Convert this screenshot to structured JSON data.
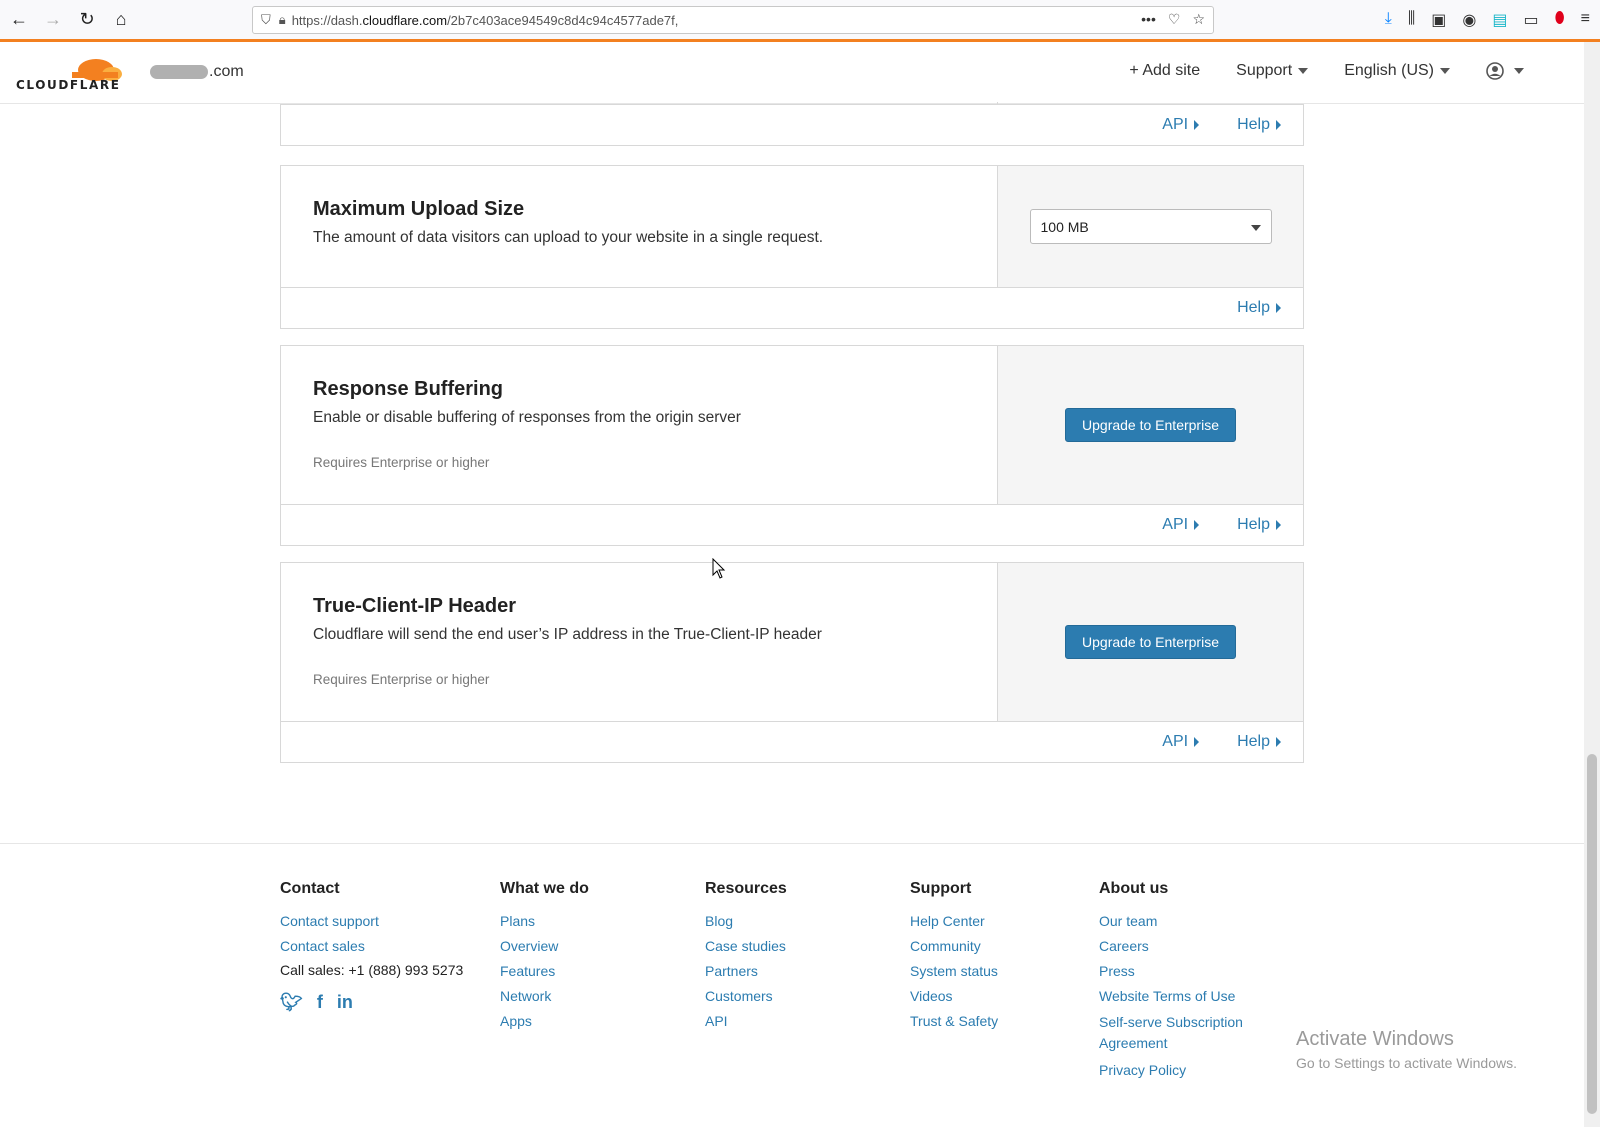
{
  "browser": {
    "url_prefix": "https://dash.",
    "url_host": "cloudflare.com",
    "url_path": "/2b7c403ace94549c8d4c94c4577ade7f,"
  },
  "header": {
    "logo_text": "CLOUDFLARE",
    "domain_suffix": ".com",
    "add_site": "+ Add site",
    "support": "Support",
    "language": "English (US)"
  },
  "top_card": {
    "api": "API",
    "help": "Help"
  },
  "cards": [
    {
      "title": "Maximum Upload Size",
      "desc": "The amount of data visitors can upload to your website in a single request.",
      "select_value": "100 MB",
      "help": "Help"
    },
    {
      "title": "Response Buffering",
      "desc": "Enable or disable buffering of responses from the origin server",
      "note": "Requires Enterprise or higher",
      "button": "Upgrade to Enterprise",
      "api": "API",
      "help": "Help"
    },
    {
      "title": "True-Client-IP Header",
      "desc": "Cloudflare will send the end user’s IP address in the True-Client-IP header",
      "note": "Requires Enterprise or higher",
      "button": "Upgrade to Enterprise",
      "api": "API",
      "help": "Help"
    }
  ],
  "footer": {
    "contact": {
      "title": "Contact",
      "links": [
        "Contact support",
        "Contact sales"
      ],
      "phone": "Call sales: +1 (888) 993 5273"
    },
    "what_we_do": {
      "title": "What we do",
      "links": [
        "Plans",
        "Overview",
        "Features",
        "Network",
        "Apps"
      ]
    },
    "resources": {
      "title": "Resources",
      "links": [
        "Blog",
        "Case studies",
        "Partners",
        "Customers",
        "API"
      ]
    },
    "support": {
      "title": "Support",
      "links": [
        "Help Center",
        "Community",
        "System status",
        "Videos",
        "Trust & Safety"
      ]
    },
    "about": {
      "title": "About us",
      "links": [
        "Our team",
        "Careers",
        "Press",
        "Website Terms of Use",
        "Self-serve Subscription Agreement",
        "Privacy Policy"
      ]
    }
  },
  "watermark": {
    "line1": "Activate Windows",
    "line2": "Go to Settings to activate Windows."
  },
  "colors": {
    "accent": "#f38020",
    "link": "#2c7cb0"
  }
}
